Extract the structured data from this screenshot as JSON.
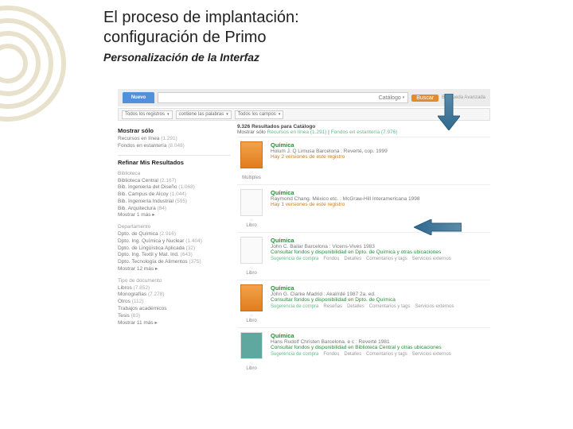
{
  "header": {
    "title_line1": "El proceso de implantación:",
    "title_line2": "configuración de Primo",
    "subtitle": "Personalización de la Interfaz"
  },
  "search": {
    "tab": "Nuevo",
    "scope": "Catálogo",
    "buscar": "Buscar",
    "advanced": "Búsqueda Avanzada"
  },
  "filters": {
    "records": "Todos los registros",
    "contains": "contiene las palabras",
    "anyfield": "Todos los campos"
  },
  "facets": {
    "h1": "Mostrar sólo",
    "l1a": "Recursos en línea",
    "l1ac": "(1.291)",
    "l1b": "Fondos en estantería",
    "l1bc": "(8.048)",
    "h2": "Refinar Mis Resultados",
    "g1": "Biblioteca",
    "g1_1": "Biblioteca Central",
    "g1_1c": "(2.167)",
    "g1_2": "Bib. Ingeniería del Diseño",
    "g1_2c": "(1.068)",
    "g1_3": "Bib. Campus de Alcoy",
    "g1_3c": "(1.044)",
    "g1_4": "Bib. Ingeniería Industrial",
    "g1_4c": "(595)",
    "g1_5": "Bib. Arquitectura",
    "g1_5c": "(84)",
    "g1_more": "Mostrar 1 más ▸",
    "g2": "Departamento",
    "g2_1": "Dpto. de Química",
    "g2_1c": "(2.916)",
    "g2_2": "Dpto. Ing. Química y Nuclear",
    "g2_2c": "(1.404)",
    "g2_3": "Dpto. de Lingüística Aplicada",
    "g2_3c": "(32)",
    "g2_4": "Dpto. Ing. Textil y Mat. Ind.",
    "g2_4c": "(643)",
    "g2_5": "Dpto. Tecnología de Alimentos",
    "g2_5c": "(375)",
    "g2_more": "Mostrar 12 más ▸",
    "g3": "Tipo de documento",
    "g3_1": "Libros",
    "g3_1c": "(7.852)",
    "g3_2": "Monografías",
    "g3_2c": "(7.278)",
    "g3_3": "Otros",
    "g3_3c": "(112)",
    "g3_4": "Trabajos académicos",
    "g3_4c": "",
    "g3_5": "Tesis",
    "g3_5c": "(83)",
    "g3_more": "Mostrar 11 más ▸"
  },
  "results": {
    "count": "9.326 Resultados para Catálogo",
    "show_only": "Mostrar sólo",
    "show_a": "Recursos en línea (1.291)",
    "show_b": "Fondos en estantería (7.976)",
    "r1": {
      "title": "Química",
      "meta": "Holum J. Q Limusa Barcelona : Reverté, cop. 1999",
      "avail": "Hay 2 versiones de este registro",
      "type": "Múltiples"
    },
    "r2": {
      "title": "Química",
      "meta": "Raymond Chang. México etc. : McGraw-Hill Interamericana 1998",
      "avail": "Hay 1 versiones de este registro",
      "type": "Libro"
    },
    "r3": {
      "title": "Química",
      "meta": "John C. Bailar Barcelona : Vicens-Vives 1983",
      "avail": "Consultar fondos y disponibilidad en Dpto. de Química y otras ubicaciones",
      "type": "Libro"
    },
    "r4": {
      "title": "Química",
      "meta": "John G. Clarke Madrid : Akal/rdé 1987 2a. ed.",
      "avail": "Consultar fondos y disponibilidad en Dpto. de Química",
      "type": "Libro"
    },
    "r5": {
      "title": "Química",
      "meta": "Hans Rudolf Christen Barcelona. e c : Reverté 1981",
      "avail": "Consultar fondos y disponibilidad en Biblioteca Central y otras ubicaciones",
      "type": "Libro"
    },
    "actions": {
      "sug": "Sugerencia de compra",
      "det": "Detalles",
      "rev": "Reseñas",
      "com": "Comentarios y tags",
      "ext": "Servicios externos",
      "fon": "Fondos"
    }
  }
}
